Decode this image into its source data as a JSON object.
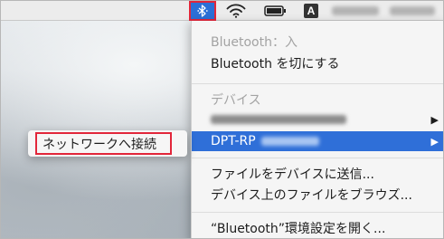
{
  "menubar": {
    "bluetooth_icon": "bluetooth-icon",
    "wifi_icon": "wifi-icon",
    "battery_icon": "battery-icon",
    "input_source_label": "A",
    "accent_color": "#2b6fd6"
  },
  "bluetooth_menu": {
    "status": "Bluetooth：入",
    "toggle_label": "Bluetooth を切にする",
    "devices_header": "デバイス",
    "devices": [
      {
        "label": ""
      },
      {
        "label": "DPT-RP"
      }
    ],
    "send_file_label": "ファイルをデバイスに送信...",
    "browse_files_label": "デバイス上のファイルをブラウズ...",
    "open_prefs_label": "“Bluetooth”環境設定を開く..."
  },
  "device_submenu": {
    "connect_label": "ネットワークへ接続"
  },
  "colors": {
    "highlight": "#2f6fd8",
    "callout_border": "#e2263a"
  }
}
